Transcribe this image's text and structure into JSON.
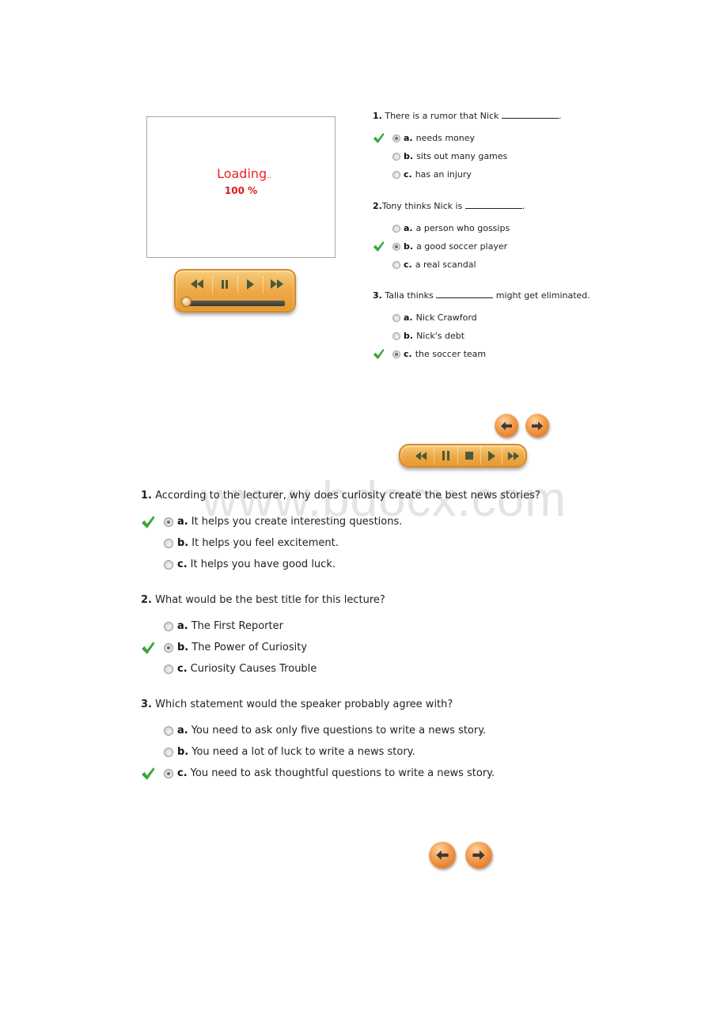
{
  "watermark": "www.bdocx.com",
  "video_panel": {
    "loading_label": "Loading",
    "loading_dots": "..",
    "progress_text": "100 %",
    "progress_percent": 100
  },
  "player_1": {
    "buttons": [
      "rewind-icon",
      "pause-icon",
      "play-icon",
      "fast-forward-icon"
    ],
    "seek_position_percent": 0
  },
  "player_2": {
    "buttons": [
      "rewind-icon",
      "pause-icon",
      "stop-icon",
      "play-icon",
      "fast-forward-icon"
    ]
  },
  "check_color": "#3aa63a",
  "accent_orange": "#eeaa48",
  "quiz_1": {
    "questions": [
      {
        "number": "1.",
        "text_before": "There is a rumor that Nick",
        "text_after": ".",
        "options": [
          {
            "letter": "a.",
            "text": "needs money",
            "selected": true,
            "correct": true
          },
          {
            "letter": "b.",
            "text": "sits out many games",
            "selected": false,
            "correct": false
          },
          {
            "letter": "c.",
            "text": "has an injury",
            "selected": false,
            "correct": false
          }
        ]
      },
      {
        "number": "2.",
        "text_before": "Tony thinks Nick is",
        "text_after": ".",
        "options": [
          {
            "letter": "a.",
            "text": "a person who gossips",
            "selected": false,
            "correct": false
          },
          {
            "letter": "b.",
            "text": "a good soccer player",
            "selected": true,
            "correct": true
          },
          {
            "letter": "c.",
            "text": "a real scandal",
            "selected": false,
            "correct": false
          }
        ]
      },
      {
        "number": "3.",
        "text_before": "Talia thinks",
        "text_after": "might get eliminated.",
        "options": [
          {
            "letter": "a.",
            "text": "Nick Crawford",
            "selected": false,
            "correct": false
          },
          {
            "letter": "b.",
            "text": "Nick's debt",
            "selected": false,
            "correct": false
          },
          {
            "letter": "c.",
            "text": "the soccer team",
            "selected": true,
            "correct": true
          }
        ]
      }
    ]
  },
  "quiz_2": {
    "questions": [
      {
        "number": "1.",
        "text": "According to the lecturer, why does curiosity create the best news stories?",
        "options": [
          {
            "letter": "a.",
            "text": "It helps you create interesting questions.",
            "selected": true,
            "correct": true
          },
          {
            "letter": "b.",
            "text": "It helps you feel excitement.",
            "selected": false,
            "correct": false
          },
          {
            "letter": "c.",
            "text": "It helps you have good luck.",
            "selected": false,
            "correct": false
          }
        ]
      },
      {
        "number": "2.",
        "text": "What would be the best title for this lecture?",
        "options": [
          {
            "letter": "a.",
            "text": "The First Reporter",
            "selected": false,
            "correct": false
          },
          {
            "letter": "b.",
            "text": "The Power of Curiosity",
            "selected": true,
            "correct": true
          },
          {
            "letter": "c.",
            "text": "Curiosity Causes Trouble",
            "selected": false,
            "correct": false
          }
        ]
      },
      {
        "number": "3.",
        "text": "Which statement would the speaker probably agree with?",
        "options": [
          {
            "letter": "a.",
            "text": "You need to ask only five questions to write a news story.",
            "selected": false,
            "correct": false
          },
          {
            "letter": "b.",
            "text": "You need a lot of luck to write a news story.",
            "selected": false,
            "correct": false
          },
          {
            "letter": "c.",
            "text": "You need to ask thoughtful questions to write a news story.",
            "selected": true,
            "correct": true
          }
        ]
      }
    ]
  }
}
